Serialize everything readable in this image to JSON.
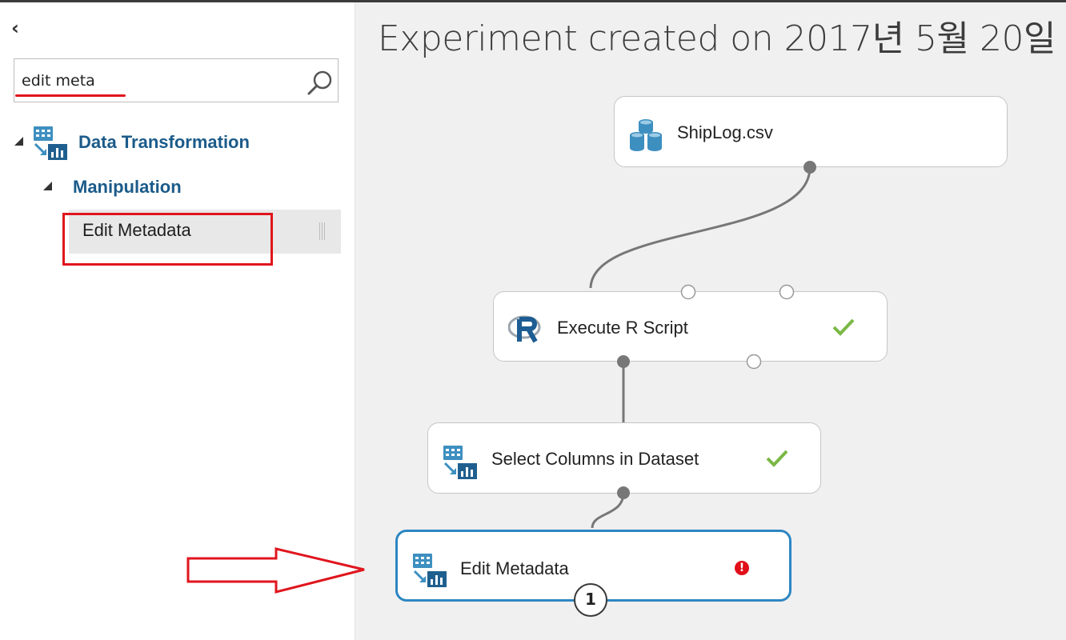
{
  "sidebar": {
    "collapse_glyph": "‹",
    "search": {
      "value": "edit meta",
      "placeholder": ""
    },
    "tree": {
      "category": "Data Transformation",
      "subcategory": "Manipulation",
      "item": "Edit Metadata"
    }
  },
  "canvas": {
    "title": "Experiment created on 2017년 5월 20일",
    "modules": {
      "shiplog": {
        "label": "ShipLog.csv",
        "icon": "dataset-icon"
      },
      "execute_r": {
        "label": "Execute R Script",
        "icon": "r-script-icon",
        "status": "success"
      },
      "select_columns": {
        "label": "Select Columns in Dataset",
        "icon": "data-transform-icon",
        "status": "success"
      },
      "edit_metadata": {
        "label": "Edit Metadata",
        "icon": "data-transform-icon",
        "status": "error",
        "error_glyph": "!",
        "badge": "1"
      }
    }
  },
  "colors": {
    "accent_blue": "#1b5b8a",
    "selected_border": "#2d86c2",
    "success_green": "#7ab845",
    "error_red": "#e0101a",
    "annotation_red": "#e0151d"
  }
}
